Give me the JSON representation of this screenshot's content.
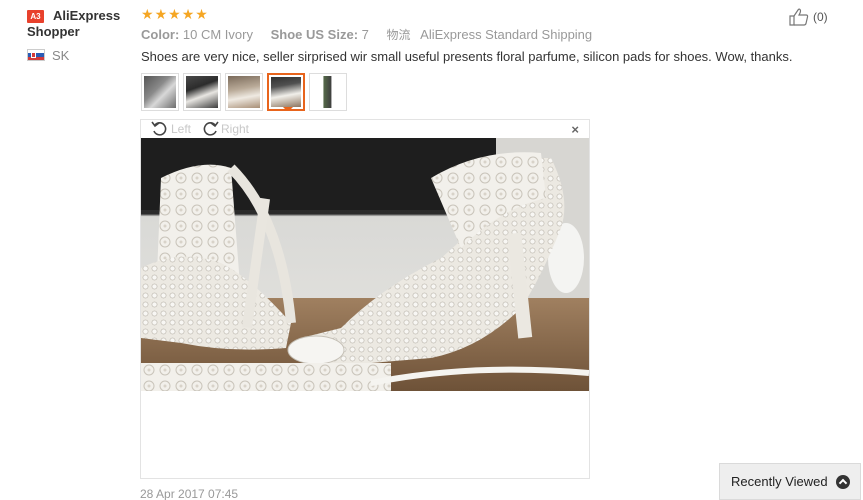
{
  "user": {
    "badge": "A3",
    "name": "AliExpress Shopper",
    "country_code": "SK",
    "flag_icon": "slovakia-flag-icon"
  },
  "review": {
    "rating": 5,
    "rating_max": 5,
    "star_color": "#f5a623",
    "attributes": [
      {
        "key": "Color:",
        "value": "10 CM Ivory"
      },
      {
        "key": "Shoe US Size:",
        "value": "7"
      }
    ],
    "shipping_icon_text": "物流",
    "shipping": "AliExpress Standard Shipping",
    "text": "Shoes are very nice, seller sirprised wir small useful presents floral parfume, silicon pads for shoes. Wow, thanks.",
    "timestamp": "28 Apr 2017 07:45"
  },
  "helpful": {
    "icon": "thumbs-up-icon",
    "count_label": "(0)"
  },
  "thumbnails": {
    "count": 5,
    "selected_index": 3,
    "selected_border_color": "#e8641c"
  },
  "viewer": {
    "rotate_left_label": "Left",
    "rotate_right_label": "Right",
    "close_label": "×"
  },
  "recently_viewed": {
    "label": "Recently Viewed",
    "icon": "chevron-up-icon"
  }
}
